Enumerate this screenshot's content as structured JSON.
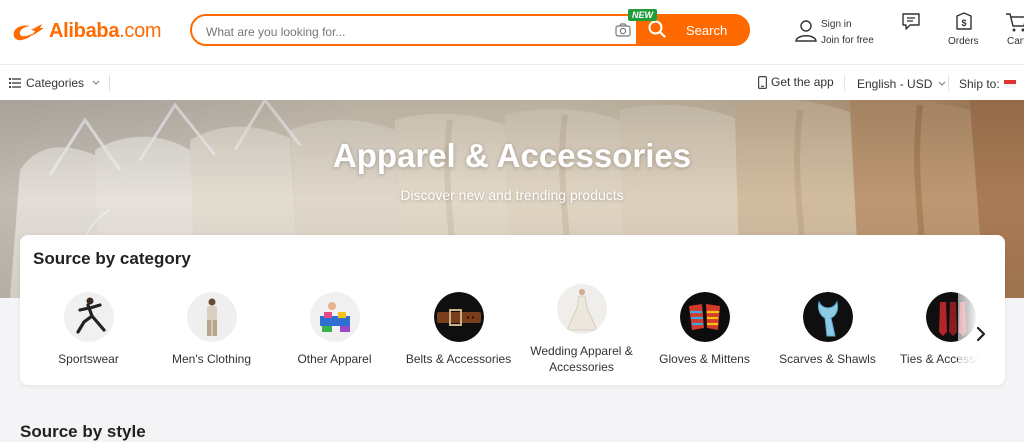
{
  "brand": {
    "logo_text": "Alibaba",
    "logo_suffix": ".com",
    "color": "#ff6a00"
  },
  "search": {
    "placeholder": "What are you looking for...",
    "button_label": "Search",
    "badge": "NEW"
  },
  "account": {
    "sign_in": "Sign in",
    "join": "Join for free",
    "orders": "Orders",
    "cart": "Cart"
  },
  "subnav": {
    "categories": "Categories",
    "get_app": "Get the app",
    "language": "English - USD",
    "ship_to": "Ship to:"
  },
  "hero": {
    "title": "Apparel & Accessories",
    "subtitle": "Discover new and trending products"
  },
  "category_section": {
    "title": "Source by category",
    "items": [
      {
        "label": "Sportswear",
        "icon": "sportswear-image"
      },
      {
        "label": "Men's Clothing",
        "icon": "mens-clothing-image"
      },
      {
        "label": "Other Apparel",
        "icon": "other-apparel-image"
      },
      {
        "label": "Belts & Accessories",
        "icon": "belt-image"
      },
      {
        "label": "Wedding Apparel & Accessories",
        "icon": "wedding-dress-image"
      },
      {
        "label": "Gloves & Mittens",
        "icon": "gloves-image"
      },
      {
        "label": "Scarves & Shawls",
        "icon": "scarf-image"
      },
      {
        "label": "Ties & Accessories",
        "icon": "ties-image"
      }
    ]
  },
  "next_section": {
    "title": "Source by style"
  }
}
